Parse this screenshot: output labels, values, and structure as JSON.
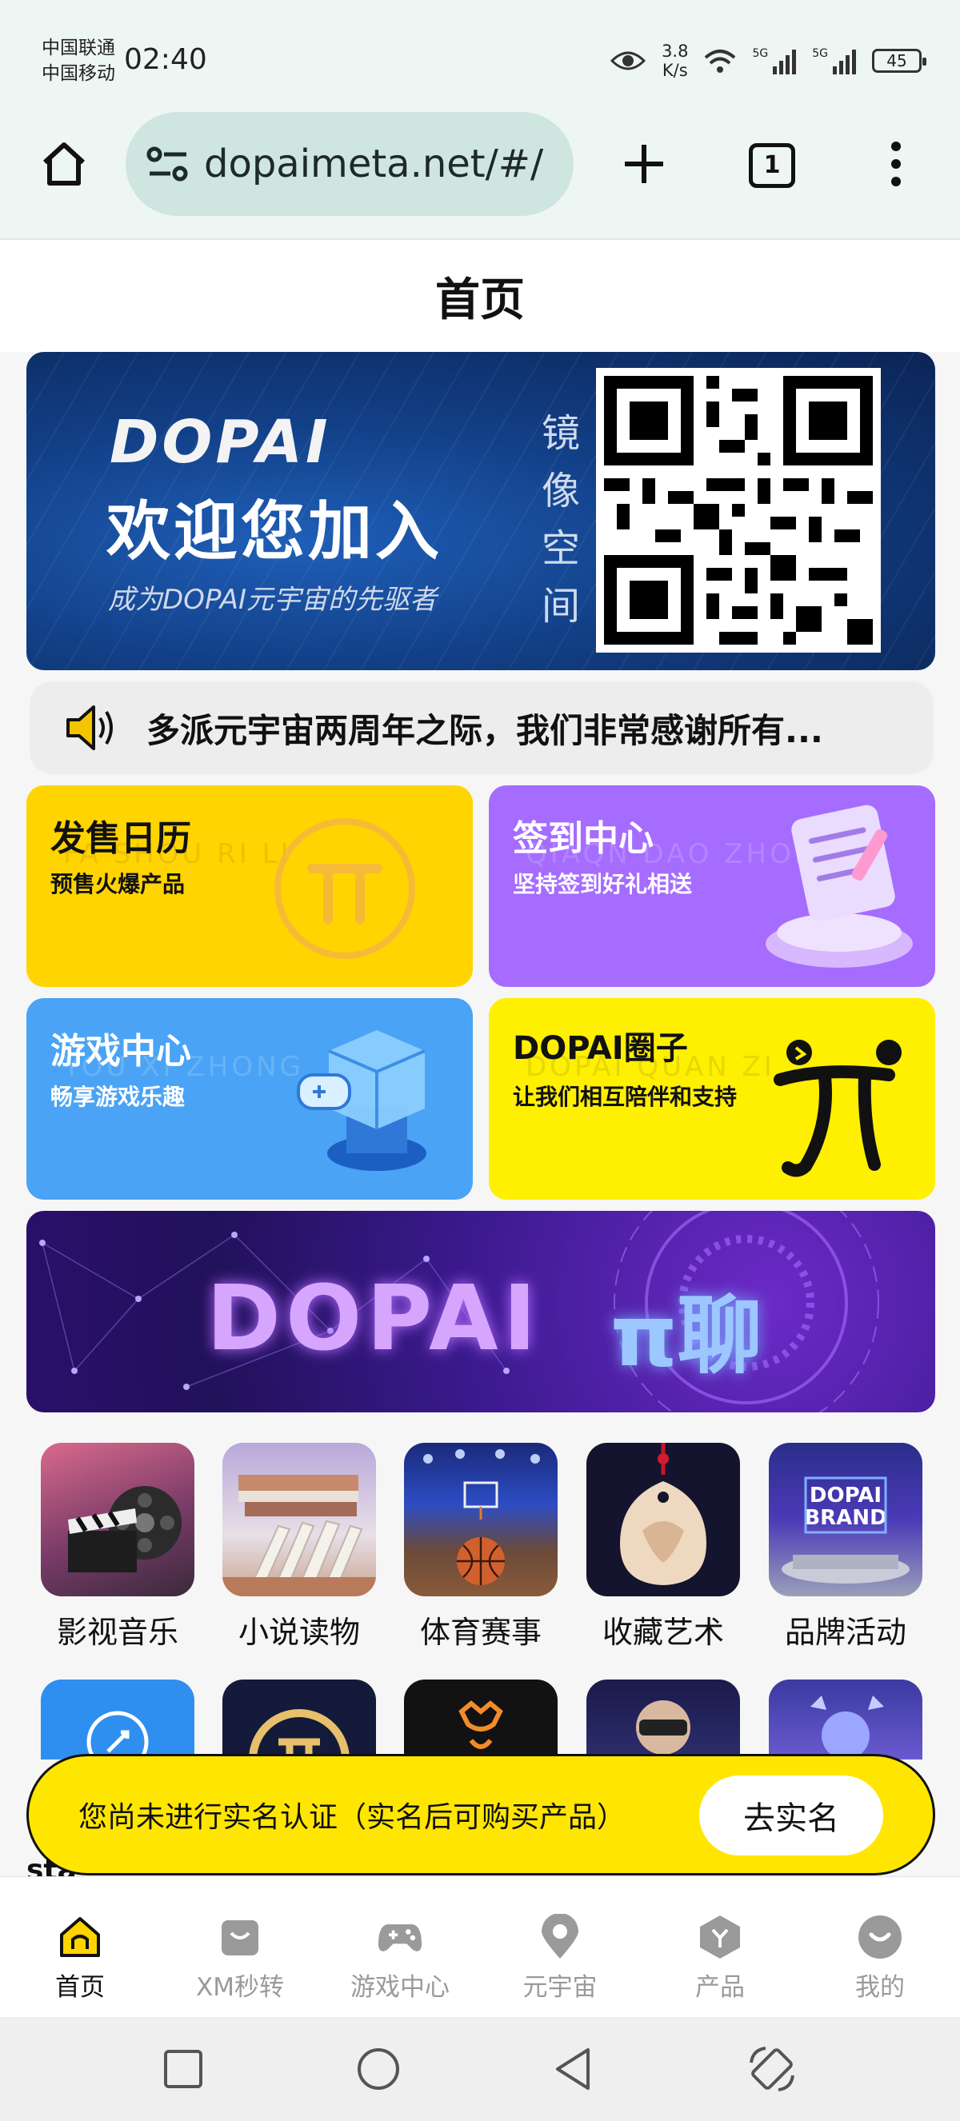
{
  "status_bar": {
    "carrier_1": "中国联通",
    "carrier_2": "中国移动",
    "time": "02:40",
    "speed_value": "3.8",
    "speed_unit": "K/s",
    "net_type_1": "5G",
    "net_type_2": "5G",
    "battery": "45"
  },
  "browser": {
    "url": "dopaimeta.net/#/",
    "tab_count": "1"
  },
  "page": {
    "title": "首页"
  },
  "banner": {
    "brand": "DOPAI",
    "welcome": "欢迎您加入",
    "subtitle": "成为DOPAI元宇宙的先驱者",
    "vertical_1": "镜",
    "vertical_2": "像",
    "vertical_3": "空",
    "vertical_4": "间"
  },
  "notice": {
    "text": "多派元宇宙两周年之际，我们非常感谢所有..."
  },
  "cards": {
    "sale": {
      "title": "发售日历",
      "subtitle": "预售火爆产品",
      "watermark": "FA SHOU RI LI"
    },
    "checkin": {
      "title": "签到中心",
      "subtitle": "坚持签到好礼相送",
      "watermark": "QIAQN DAO ZHONG"
    },
    "game": {
      "title": "游戏中心",
      "subtitle": "畅享游戏乐趣",
      "watermark": "YOU XI ZHONG"
    },
    "circle": {
      "title": "DOPAI圈子",
      "subtitle": "让我们相互陪伴和支持",
      "watermark": "DOPAI QUAN ZI"
    }
  },
  "chat_banner": {
    "brand": "DOPAI",
    "pi_chat": "π聊"
  },
  "categories": [
    {
      "label": "影视音乐"
    },
    {
      "label": "小说读物"
    },
    {
      "label": "体育赛事"
    },
    {
      "label": "收藏艺术"
    },
    {
      "label": "品牌活动",
      "image_text_1": "DOPAI",
      "image_text_2": "BRAND"
    }
  ],
  "verify": {
    "text": "您尚未进行实名认证（实名后可购买产品）",
    "button": "去实名"
  },
  "peek_text": "sta",
  "tabbar": [
    {
      "label": "首页",
      "icon": "home-icon"
    },
    {
      "label": "XM秒转",
      "icon": "shopping-bag-icon"
    },
    {
      "label": "游戏中心",
      "icon": "gamepad-icon"
    },
    {
      "label": "元宇宙",
      "icon": "location-pin-icon"
    },
    {
      "label": "产品",
      "icon": "hexagon-product-icon"
    },
    {
      "label": "我的",
      "icon": "smile-profile-icon"
    }
  ],
  "colors": {
    "accent_yellow": "#ffd400",
    "purple": "#a76bff",
    "blue": "#4aa3f5",
    "bright_yellow": "#ffef00",
    "chrome_bg": "#eef6f3"
  }
}
